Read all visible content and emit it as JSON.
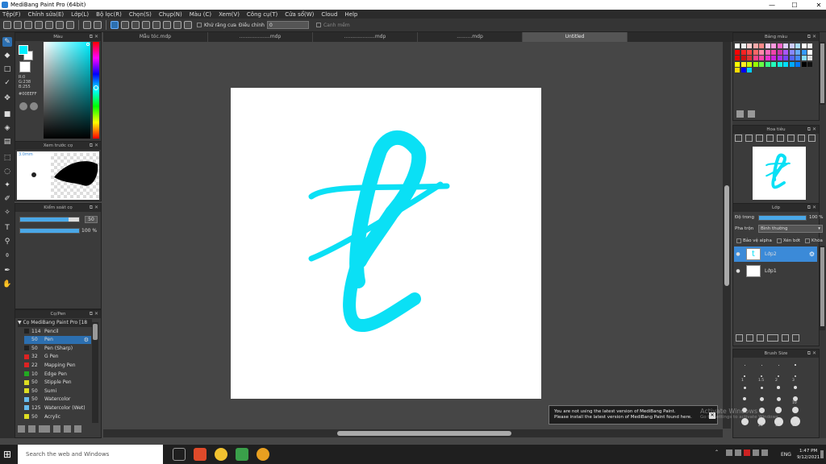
{
  "window": {
    "title": "MediBang Paint Pro (64bit)",
    "minimize": "—",
    "maximize": "☐",
    "close": "✕"
  },
  "menu": [
    "Tệp(F)",
    "Chỉnh sửa(E)",
    "Lớp(L)",
    "Bộ lọc(R)",
    "Chọn(S)",
    "Chụp(N)",
    "Màu (C)",
    "Xem(V)",
    "Công cụ(T)",
    "Cửa sổ(W)",
    "Cloud",
    "Help"
  ],
  "toolbar": {
    "antialias_label": "Khử răng cưa",
    "correction_label": "Điều chỉnh",
    "correction_value": "0",
    "snap_label": "Canh mềm"
  },
  "tabs": [
    "Mẫu tóc.mdp",
    "....................mdp",
    "....................mdp",
    "..........mdp",
    "Untitled"
  ],
  "panels": {
    "color": {
      "title": "Màu",
      "r": "R:0",
      "g": "G:238",
      "b": "B:255",
      "hex": "#00EEFF",
      "fg": "#00eeff",
      "bg": "#ffffff"
    },
    "brush_preview": {
      "title": "Xem trước cọ",
      "size": "3.0mm"
    },
    "brush_control": {
      "title": "Kiểm soát cọ",
      "size_value": "50",
      "opacity_value": "100 %",
      "size_fraction": 0.82,
      "opacity_fraction": 1.0
    },
    "brush": {
      "title": "Cọ/Pen",
      "group": "Cọ MediBang Paint Pro [18",
      "items": [
        {
          "size": "114",
          "name": "Pencil",
          "color": "#222222",
          "selected": false
        },
        {
          "size": "50",
          "name": "Pen",
          "color": "#2c6fb0",
          "selected": true
        },
        {
          "size": "50",
          "name": "Pen (Sharp)",
          "color": "#222222",
          "selected": false
        },
        {
          "size": "32",
          "name": "G Pen",
          "color": "#dd2222",
          "selected": false
        },
        {
          "size": "22",
          "name": "Mapping Pen",
          "color": "#dd2222",
          "selected": false
        },
        {
          "size": "10",
          "name": "Edge Pen",
          "color": "#22aa22",
          "selected": false
        },
        {
          "size": "50",
          "name": "Stipple Pen",
          "color": "#dddd22",
          "selected": false
        },
        {
          "size": "50",
          "name": "Sumi",
          "color": "#dddd22",
          "selected": false
        },
        {
          "size": "50",
          "name": "Watercolor",
          "color": "#66bbee",
          "selected": false
        },
        {
          "size": "125",
          "name": "Watercolor (Wet)",
          "color": "#66bbee",
          "selected": false
        },
        {
          "size": "50",
          "name": "Acrylic",
          "color": "#dddd22",
          "selected": false
        }
      ]
    },
    "palette": {
      "title": "Bảng màu"
    },
    "navigator": {
      "title": "Hoa tiêu"
    },
    "layer": {
      "title": "Lớp",
      "opacity_label": "Độ trong",
      "opacity_value": "100 %",
      "opacity_fraction": 1.0,
      "blend_label": "Pha trộn",
      "blend_value": "Bình thường",
      "protect_alpha": "Bảo vệ alpha",
      "clipping": "Xén bớt",
      "lock": "Khóa",
      "layers": [
        {
          "name": "Lớp2",
          "selected": true
        },
        {
          "name": "Lớp1",
          "selected": false
        }
      ]
    },
    "brush_size": {
      "title": "Brush Size",
      "labels": [
        "",
        "",
        "",
        "",
        "1",
        "1.5",
        "2",
        "3",
        "",
        "",
        "",
        "",
        "",
        "",
        "",
        "10",
        "",
        "",
        "",
        "",
        "",
        "20",
        "30",
        "35"
      ]
    }
  },
  "notification": {
    "line1": "You are not using the latest version of MediBang Paint.",
    "line2": "Please install the latest version of MediBang Paint found here."
  },
  "watermark": {
    "line1": "Activate Windows",
    "line2": "Go to Settings to activate Windows."
  },
  "taskbar": {
    "search_placeholder": "Search the web and Windows",
    "lang": "ENG",
    "time": "1:47 PM",
    "date": "9/12/2021"
  },
  "palette_colors": [
    "#ffffff",
    "#eeeeee",
    "#ffcccc",
    "#ffaaaa",
    "#ff8888",
    "#ffccee",
    "#ff99dd",
    "#ff66cc",
    "#ddccff",
    "#ccccff",
    "#aaddff",
    "#ffffff",
    "#eeeeee",
    "#ff0000",
    "#ff2222",
    "#ff4444",
    "#ff6666",
    "#ff88aa",
    "#ff66bb",
    "#ee44aa",
    "#cc33aa",
    "#aa55ff",
    "#8888ff",
    "#66aaff",
    "#3399ff",
    "#ffffff",
    "#ee0000",
    "#cc1111",
    "#dd3333",
    "#ff4488",
    "#ff44aa",
    "#ee33cc",
    "#cc22dd",
    "#aa33ee",
    "#7744ff",
    "#5566ff",
    "#4488ff",
    "#88ddff",
    "#dddddd",
    "#ffff00",
    "#ffee22",
    "#ccff00",
    "#99ff00",
    "#66ff44",
    "#33ff88",
    "#22ffbb",
    "#11eedd",
    "#00ddff",
    "#00aaff",
    "#0077ff",
    "#000000",
    "#111111",
    "#ffdd00",
    "#0000ff",
    "#00ccff"
  ]
}
